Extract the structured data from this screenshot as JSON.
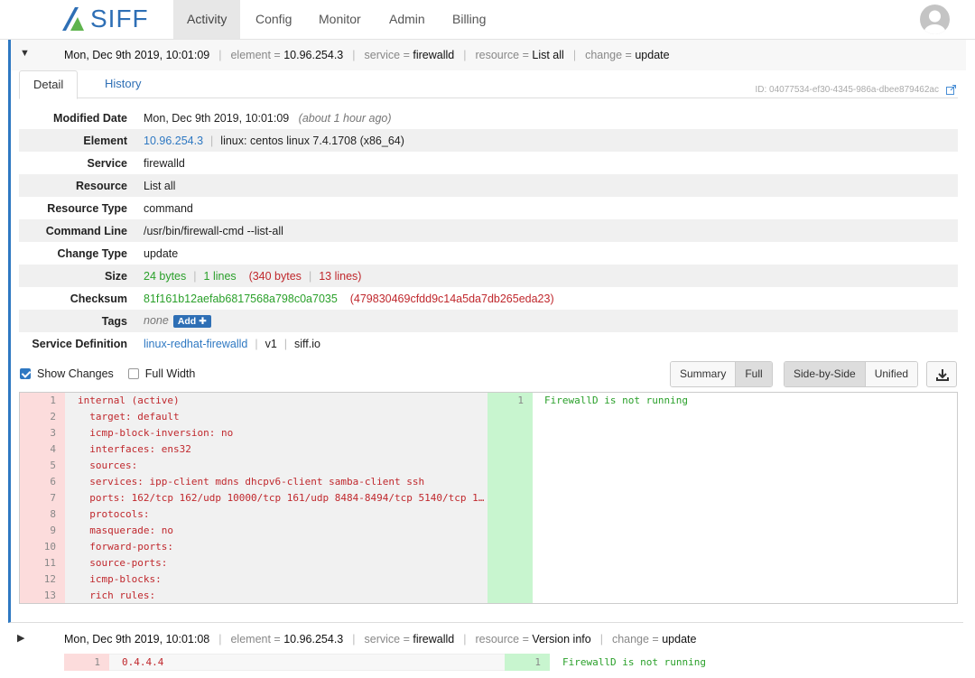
{
  "app": {
    "logo_text": "SIFF"
  },
  "nav": {
    "tabs": [
      {
        "label": "Activity"
      },
      {
        "label": "Config"
      },
      {
        "label": "Monitor"
      },
      {
        "label": "Admin"
      },
      {
        "label": "Billing"
      }
    ]
  },
  "entry": {
    "timestamp": "Mon, Dec 9th 2019, 10:01:09",
    "element_key": "element =",
    "element_value": "10.96.254.3",
    "service_key": "service =",
    "service_value": "firewalld",
    "resource_key": "resource =",
    "resource_value": "List all",
    "change_key": "change =",
    "change_value": "update",
    "id_label": "ID: 04077534-ef30-4345-986a-dbee879462ac",
    "tabs": {
      "detail": "Detail",
      "history": "History"
    }
  },
  "props": {
    "modified_date_label": "Modified Date",
    "modified_date": "Mon, Dec 9th 2019, 10:01:09",
    "modified_relative": "(about 1 hour ago)",
    "element_label": "Element",
    "element_ip": "10.96.254.3",
    "element_os": "linux: centos linux 7.4.1708 (x86_64)",
    "service_label": "Service",
    "service": "firewalld",
    "resource_label": "Resource",
    "resource": "List all",
    "resource_type_label": "Resource Type",
    "resource_type": "command",
    "command_line_label": "Command Line",
    "command_line": "/usr/bin/firewall-cmd --list-all",
    "change_type_label": "Change Type",
    "change_type": "update",
    "size_label": "Size",
    "size_new_bytes": "24 bytes",
    "size_new_lines": "1 lines",
    "size_old_bytes": "(340 bytes",
    "size_old_lines": "13 lines)",
    "checksum_label": "Checksum",
    "checksum_new": "81f161b12aefab6817568a798c0a7035",
    "checksum_old": "(479830469cfdd9c14a5da7db265eda23)",
    "tags_label": "Tags",
    "tags_value": "none",
    "add_label": "Add",
    "service_def_label": "Service Definition",
    "service_def_name": "linux-redhat-firewalld",
    "service_def_version": "v1",
    "service_def_source": "siff.io"
  },
  "options": {
    "show_changes": "Show Changes",
    "full_width": "Full Width",
    "summary": "Summary",
    "full": "Full",
    "side_by_side": "Side-by-Side",
    "unified": "Unified"
  },
  "diff": {
    "left": [
      {
        "n": "1",
        "t": "internal (active)"
      },
      {
        "n": "2",
        "t": "  target: default"
      },
      {
        "n": "3",
        "t": "  icmp-block-inversion: no"
      },
      {
        "n": "4",
        "t": "  interfaces: ens32"
      },
      {
        "n": "5",
        "t": "  sources:"
      },
      {
        "n": "6",
        "t": "  services: ipp-client mdns dhcpv6-client samba-client ssh"
      },
      {
        "n": "7",
        "t": "  ports: 162/tcp 162/udp 10000/tcp 161/udp 8484-8494/tcp 5140/tcp 1…"
      },
      {
        "n": "8",
        "t": "  protocols:"
      },
      {
        "n": "9",
        "t": "  masquerade: no"
      },
      {
        "n": "10",
        "t": "  forward-ports:"
      },
      {
        "n": "11",
        "t": "  source-ports:"
      },
      {
        "n": "12",
        "t": "  icmp-blocks:"
      },
      {
        "n": "13",
        "t": "  rich rules:"
      }
    ],
    "right": [
      {
        "n": "1",
        "t": "FirewallD is not running"
      }
    ]
  },
  "entry2": {
    "timestamp": "Mon, Dec 9th 2019, 10:01:08",
    "element_key": "element =",
    "element_value": "10.96.254.3",
    "service_key": "service =",
    "service_value": "firewalld",
    "resource_key": "resource =",
    "resource_value": "Version info",
    "change_key": "change =",
    "change_value": "update",
    "left_n": "1",
    "left_t": "0.4.4.4",
    "right_n": "1",
    "right_t": "FirewallD is not running"
  },
  "colors": {
    "accent": "#2e78c2",
    "deleted_bg": "#fcdcdc",
    "added_bg": "#c8f5cf",
    "deleted_text": "#c0282d",
    "added_text": "#2aa02a"
  }
}
